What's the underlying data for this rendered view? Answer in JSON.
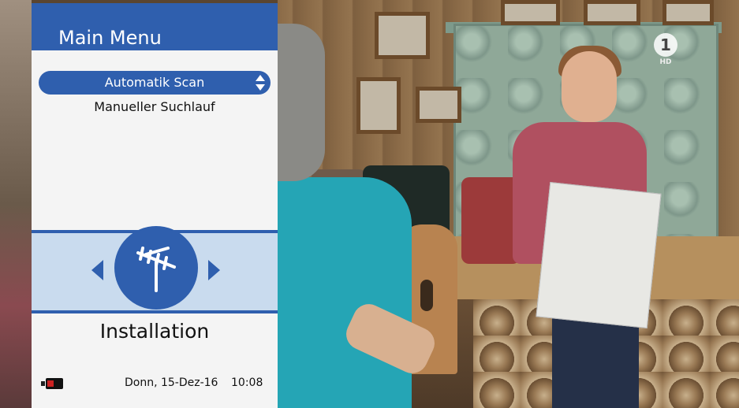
{
  "panel": {
    "title": "Main Menu",
    "items": [
      {
        "label": "Automatik Scan",
        "selected": true
      },
      {
        "label": "Manueller Suchlauf",
        "selected": false
      }
    ],
    "section": {
      "label": "Installation",
      "icon": "antenna-icon"
    },
    "footer": {
      "date": "Donn, 15-Dez-16",
      "time": "10:08",
      "icon": "signal-card-icon"
    }
  },
  "channel_logo": {
    "number": "1",
    "hd": "HD"
  },
  "colors": {
    "accent": "#2f5fae",
    "band": "#c9dbee",
    "panel": "#f4f4f4"
  }
}
